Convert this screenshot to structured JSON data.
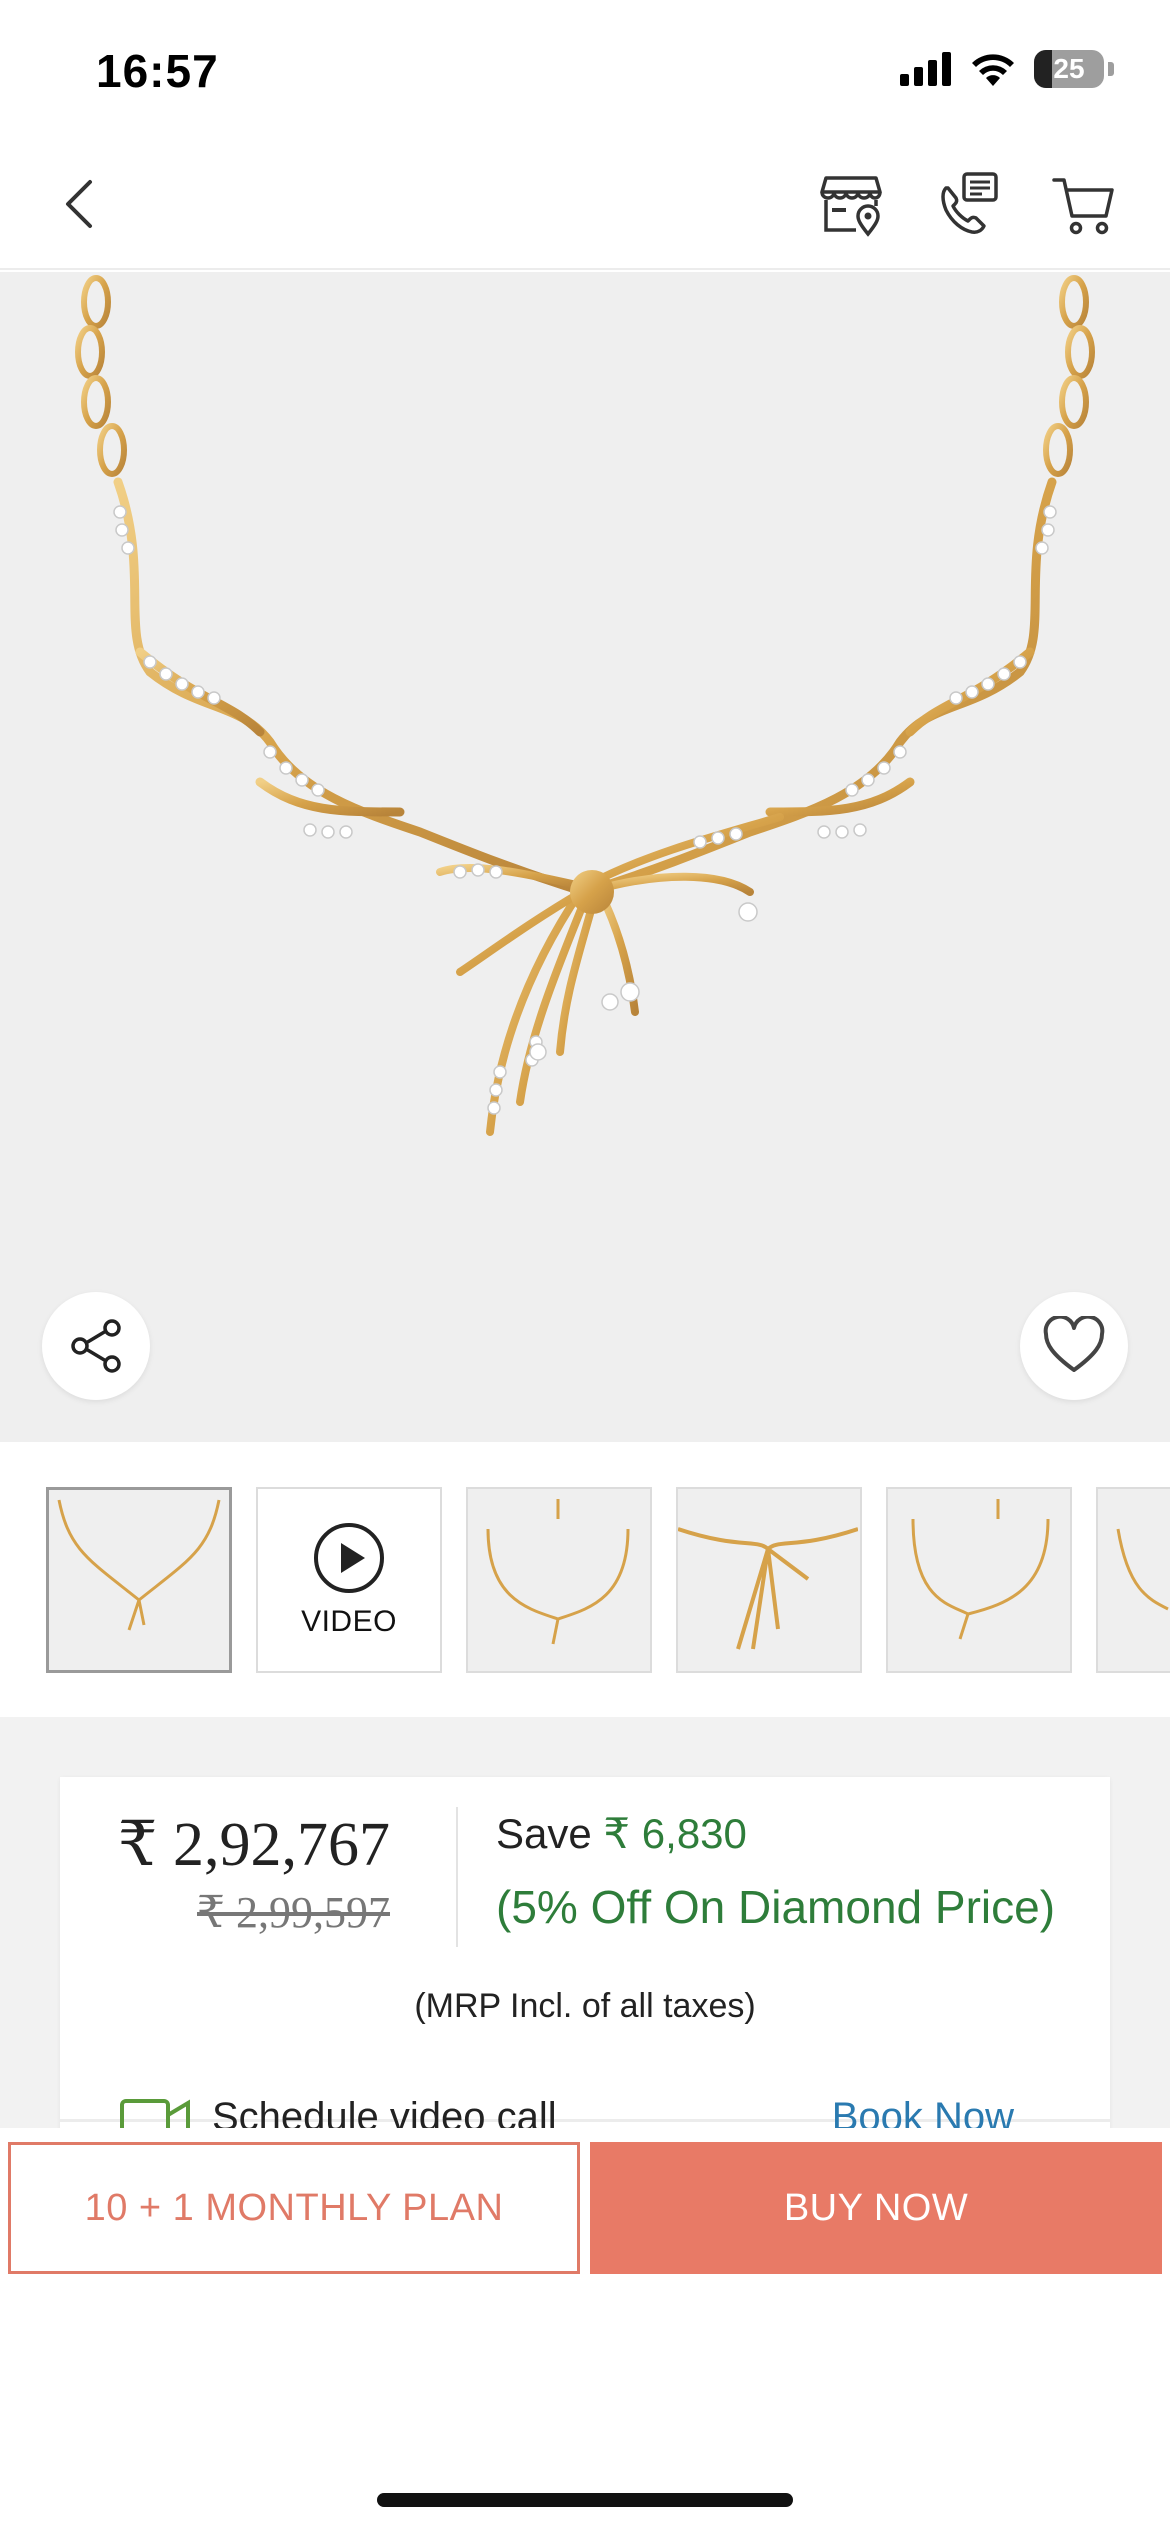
{
  "status_bar": {
    "time": "16:57",
    "battery_level": "25",
    "icons": [
      "signal-icon",
      "wifi-icon",
      "battery-icon"
    ]
  },
  "nav": {
    "icons": [
      "back-icon",
      "store-locator-icon",
      "call-support-icon",
      "cart-icon"
    ]
  },
  "hero": {
    "icons": [
      "share-icon",
      "heart-icon"
    ]
  },
  "thumbnails": {
    "video_label": "VIDEO",
    "selected_index": 0
  },
  "price": {
    "current": "₹ 2,92,767",
    "mrp": "₹ 2,99,597",
    "save_label": "Save",
    "save_amount": "₹ 6,830",
    "discount_note": "(5% Off On Diamond Price)",
    "tax_note": "(MRP Incl. of all taxes)"
  },
  "video_call": {
    "label": "Schedule video call",
    "link": "Book Now"
  },
  "actions": {
    "plan_label": "10 + 1 MONTHLY PLAN",
    "buy_label": "BUY NOW"
  },
  "colors": {
    "accent": "#e87a66",
    "save_green": "#2e7d3a",
    "gold": "#d9a84e",
    "link_blue": "#2a7ab0"
  }
}
